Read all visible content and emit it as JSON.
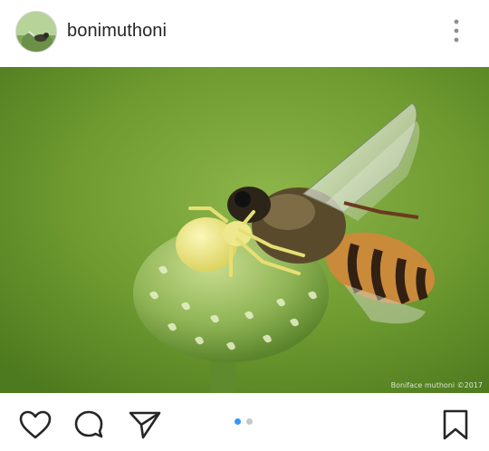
{
  "post": {
    "username": "bonimuthoni",
    "image_alt": "Yellow crab spider holding a honeybee on a green flower bud",
    "watermark": "Boniface muthoni ©2017"
  },
  "icons": {
    "avatar": "profile-photo",
    "more": "more-vertical-icon",
    "like": "heart-icon",
    "comment": "comment-icon",
    "share": "send-icon",
    "save": "bookmark-icon"
  },
  "carousel": {
    "total": 2,
    "active": 1
  },
  "colors": {
    "text": "#262626",
    "dot_active": "#3897f0",
    "dot_inactive": "#c7c7c7",
    "icon": "#262626"
  }
}
